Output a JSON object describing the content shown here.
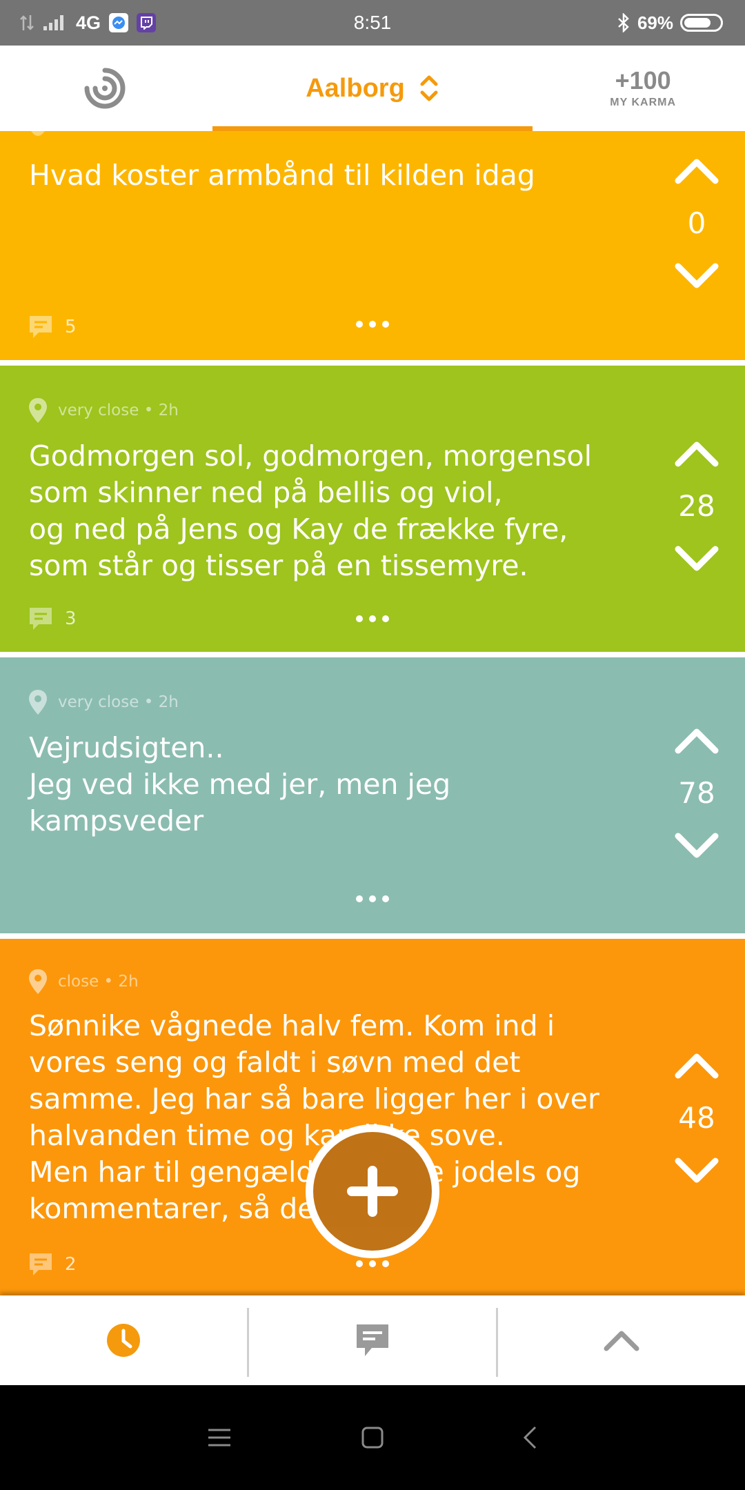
{
  "status_bar": {
    "network": "4G",
    "time": "8:51",
    "battery": "69%"
  },
  "header": {
    "city": "Aalborg",
    "karma_value": "+100",
    "karma_label": "MY KARMA"
  },
  "posts": [
    {
      "meta": "",
      "text": "Hvad koster armbånd til kilden idag",
      "votes": "0",
      "comments": "5",
      "color": "#fdb600"
    },
    {
      "meta": "very close • 2h",
      "text": "Godmorgen sol, godmorgen, morgensol\nsom skinner ned på bellis og viol,\nog ned på Jens og Kay de frække fyre,\nsom står og tisser på en tissemyre.",
      "votes": "28",
      "comments": "3",
      "color": "#9ec41d"
    },
    {
      "meta": "very close • 2h",
      "text": "Vejrudsigten..\nJeg ved ikke med jer, men jeg\nkampsveder",
      "votes": "78",
      "comments": "",
      "color": "#8bbcb0"
    },
    {
      "meta": "close • 2h",
      "text": "Sønnike vågnede halv fem. Kom ind i\nvores seng og faldt i søvn med det\nsamme. Jeg har så bare ligger her i over\nhalvanden time og kan ikke sove.\nMen har til gengæld læst alle jodels og\nkommentarer, så deeeet....",
      "votes": "48",
      "comments": "2",
      "color": "#fc970b"
    }
  ],
  "colors": {
    "accent": "#f59a0c",
    "fab": "#bd6b0b",
    "nav_inactive": "#9a9a9a"
  },
  "bottom_nav": {
    "items": [
      "recent-tab",
      "discussed-tab",
      "top-tab"
    ]
  }
}
